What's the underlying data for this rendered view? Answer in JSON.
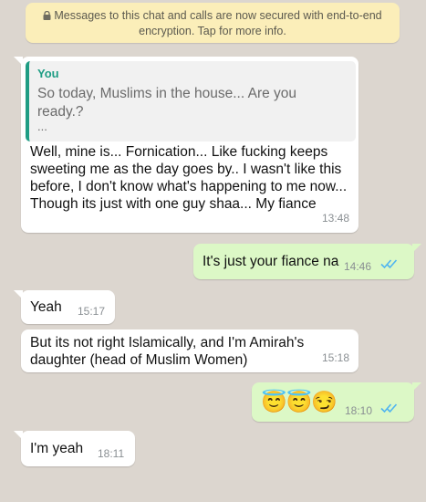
{
  "system_notice": {
    "lock_icon": "lock-icon",
    "line1": "Messages to this chat and calls are now secured with end-to-end",
    "line2": "encryption. Tap for more info."
  },
  "colors": {
    "chat_background": "#dcd6cf",
    "incoming_bubble": "#ffffff",
    "outgoing_bubble": "#dcf8c6",
    "notice_background": "#fbeeb9",
    "quote_accent": "#1f9d84",
    "read_ticks": "#4fb4f0"
  },
  "messages": [
    {
      "direction": "incoming",
      "quote": {
        "author": "You",
        "line1": "So today, Muslims in the house... Are you",
        "line2": "ready.?",
        "more": "..."
      },
      "lines": [
        "Well, mine is... Fornication...  Like fucking keeps",
        "sweeting me as the day goes by..  I wasn't like this",
        "before,  I don't know what's happening to me now...",
        "Though its just with one guy shaa...  My fiance"
      ],
      "time": "13:48"
    },
    {
      "direction": "outgoing",
      "text": "It's just your fiance na",
      "time": "14:46",
      "status": "read"
    },
    {
      "direction": "incoming",
      "text": "Yeah",
      "time": "15:17"
    },
    {
      "direction": "incoming",
      "lines": [
        "But its not right Islamically,  and I'm Amirah's",
        "daughter (head of Muslim Women)"
      ],
      "time": "15:18"
    },
    {
      "direction": "outgoing",
      "emoji": "😇😇😏",
      "emoji_names": [
        "smiling-face-with-halo",
        "smiling-face-with-halo",
        "smirking-face"
      ],
      "time": "18:10",
      "status": "read"
    },
    {
      "direction": "incoming",
      "text": "I'm yeah",
      "time": "18:11"
    }
  ]
}
